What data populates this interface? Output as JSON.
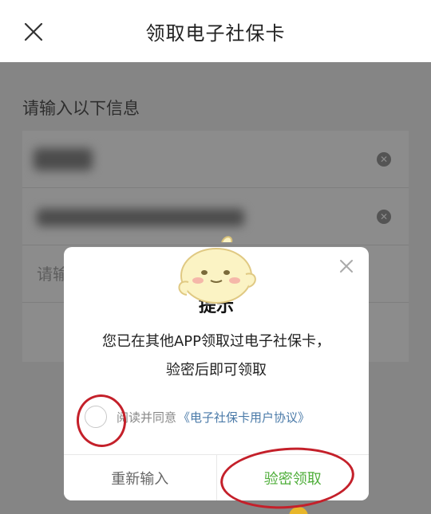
{
  "header": {
    "title": "领取电子社保卡",
    "close_icon": "close-icon"
  },
  "form": {
    "section_title": "请输入以下信息",
    "rows": [
      {
        "value": "",
        "clear_icon": "clear-icon"
      },
      {
        "value": "",
        "clear_icon": "clear-icon"
      },
      {
        "placeholder": "请输入"
      },
      {
        "value": ""
      }
    ]
  },
  "dialog": {
    "title": "提示",
    "message_line1": "您已在其他APP领取过电子社保卡，",
    "message_line2": "验密后即可领取",
    "agree_text": "阅读并同意",
    "agree_link": "《电子社保卡用户协议》",
    "reenter_label": "重新输入",
    "verify_label": "验密领取",
    "close_icon": "close-icon"
  },
  "colors": {
    "accent_green": "#4fae3a",
    "link_blue": "#4a7aa8",
    "annotation_red": "#c4202a"
  }
}
